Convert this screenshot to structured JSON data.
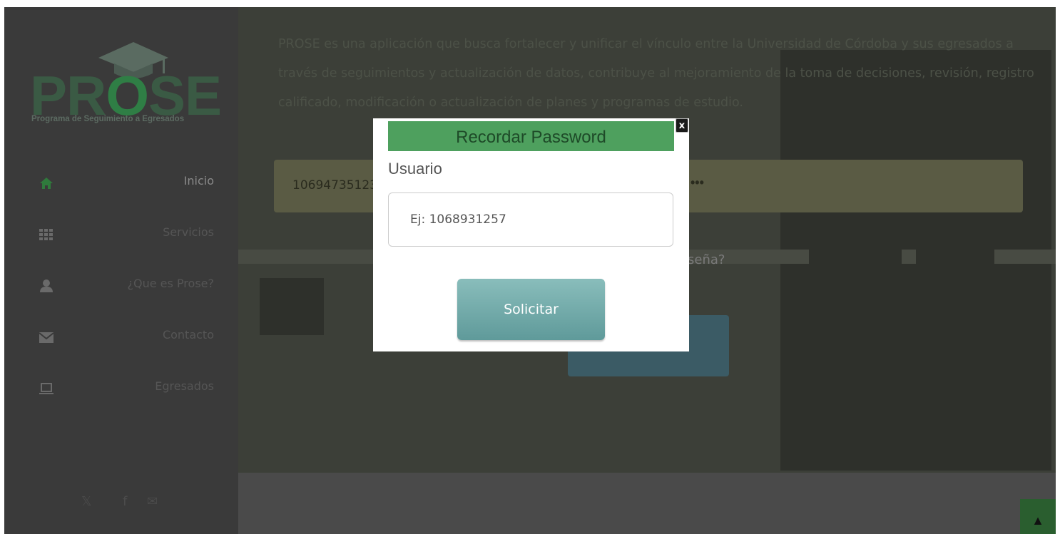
{
  "brand": {
    "logo_text_pre": "PR",
    "logo_text_o": "O",
    "logo_text_post": "SE",
    "tagline": "Programa de Seguimiento a Egresados"
  },
  "sidebar": {
    "items": [
      {
        "label": "Inicio",
        "icon": "home-icon"
      },
      {
        "label": "Servicios",
        "icon": "grid-icon"
      },
      {
        "label": "¿Que es Prose?",
        "icon": "user-icon"
      },
      {
        "label": "Contacto",
        "icon": "envelope-icon"
      },
      {
        "label": "Egresados",
        "icon": "laptop-icon"
      }
    ],
    "social": {
      "twitter": "𝕏",
      "facebook": "f",
      "mail": "✉"
    }
  },
  "main": {
    "intro": "PROSE es una aplicación que busca fortalecer y unificar el vínculo entre la Universidad de Córdoba y sus egresados a través de seguimientos y actualización de datos, contribuye al mejoramiento de la toma de decisiones, revisión, registro calificado, modificación o actualización de planes y programas de estudio.",
    "username_value": "10694735123",
    "password_mask": "•••",
    "forgot_text": "seña?",
    "scroll_top": "▲"
  },
  "modal": {
    "title": "Recordar Password",
    "close": "x",
    "field_label": "Usuario",
    "placeholder": "Ej: 1068931257",
    "submit": "Solicitar"
  },
  "colors": {
    "accent_green": "#4ea05e",
    "button_teal": "#6fa8a7",
    "sidebar_bg": "#3a3a3a"
  }
}
